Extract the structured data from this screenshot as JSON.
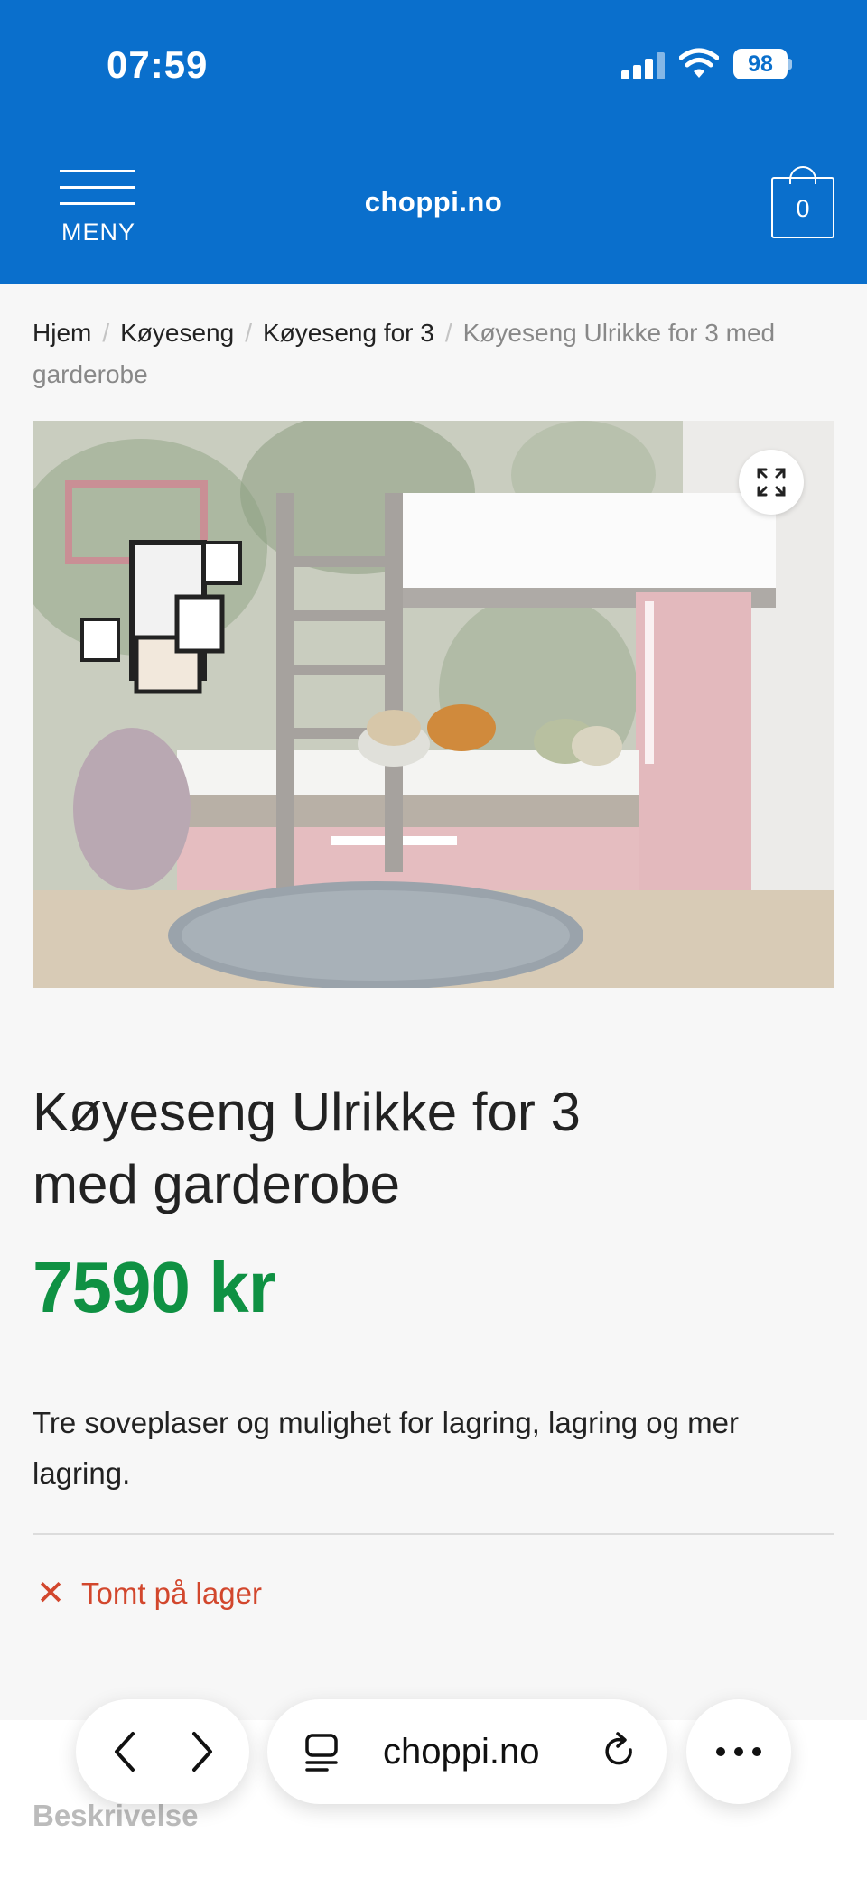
{
  "status_bar": {
    "time": "07:59",
    "battery": "98"
  },
  "header": {
    "menu_label": "MENY",
    "logo": "choppi.no",
    "cart_count": "0"
  },
  "breadcrumb": {
    "items": [
      "Hjem",
      "Køyeseng",
      "Køyeseng for 3"
    ],
    "current": "Køyeseng Ulrikke for 3 med garderobe",
    "separator": "/"
  },
  "product": {
    "title": "Køyeseng Ulrikke for 3 med garderobe",
    "price": "7590 kr",
    "description": "Tre soveplaser og mulighet for lagring, lagring og mer lagring.",
    "stock_status": "Tomt på lager"
  },
  "tabs": {
    "description": "Beskrivelse"
  },
  "browser": {
    "url": "choppi.no"
  },
  "colors": {
    "brand": "#0a6fcc",
    "price": "#0f9143",
    "out_of_stock": "#d2472d"
  }
}
